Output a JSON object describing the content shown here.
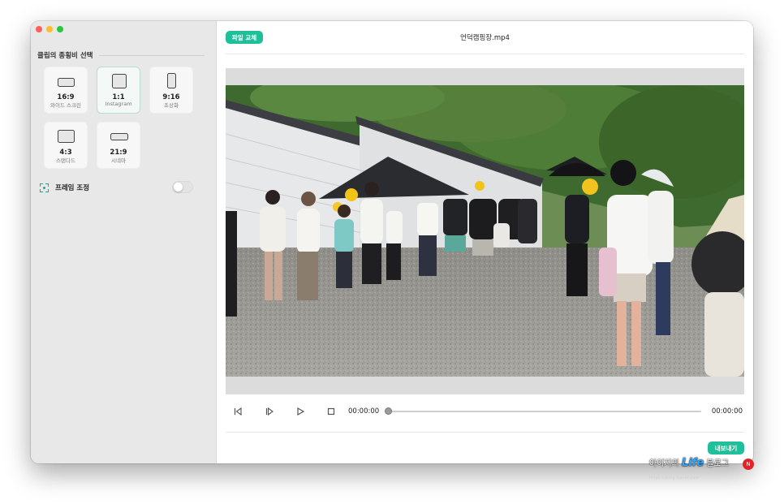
{
  "sidebar": {
    "section_title": "클립의 종횡비 선택",
    "ratios": [
      {
        "label": "16:9",
        "sub": "와이드 스크린",
        "icon": "widescreen-ratio-icon"
      },
      {
        "label": "1:1",
        "sub": "Instagram",
        "icon": "square-ratio-icon",
        "selected": true
      },
      {
        "label": "9:16",
        "sub": "초상화",
        "icon": "portrait-ratio-icon"
      },
      {
        "label": "4:3",
        "sub": "스탠다드",
        "icon": "standard-ratio-icon"
      },
      {
        "label": "21:9",
        "sub": "시네마",
        "icon": "cinema-ratio-icon"
      }
    ],
    "frame_adjust": {
      "label": "프레임 조정",
      "toggle_on": false
    }
  },
  "header": {
    "replace_button": "파일 교체",
    "file_name": "언덕캠핑장.mp4"
  },
  "player": {
    "current_time": "00:00:00",
    "total_time": "00:00:00",
    "progress": 0
  },
  "footer": {
    "export_button": "내보내기"
  },
  "watermark": {
    "prefix": "아이지의",
    "brand": "Life",
    "suffix": "블로그",
    "badge": "N",
    "sub": "https://blog.naver.com"
  },
  "colors": {
    "accent": "#1fbf9a",
    "sidebar_bg": "#e8e8e8",
    "letterbox": "#dcdcdc"
  }
}
